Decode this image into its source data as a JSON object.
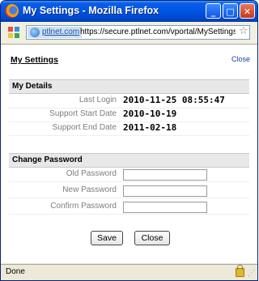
{
  "window": {
    "title": "My Settings - Mozilla Firefox"
  },
  "addressbar": {
    "site": "ptlnet.com",
    "url": "https://secure.ptlnet.com/vportal/MySettings.php?"
  },
  "page": {
    "heading": "My Settings",
    "close_link": "Close"
  },
  "details": {
    "header": "My Details",
    "rows": [
      {
        "label": "Last Login",
        "value": "2010-11-25 08:55:47"
      },
      {
        "label": "Support Start Date",
        "value": "2010-10-19"
      },
      {
        "label": "Support End Date",
        "value": "2011-02-18"
      }
    ]
  },
  "password": {
    "header": "Change Password",
    "fields": [
      {
        "label": "Old Password",
        "value": ""
      },
      {
        "label": "New Password",
        "value": ""
      },
      {
        "label": "Confirm Password",
        "value": ""
      }
    ]
  },
  "buttons": {
    "save": "Save",
    "close": "Close"
  },
  "status": {
    "text": "Done"
  }
}
